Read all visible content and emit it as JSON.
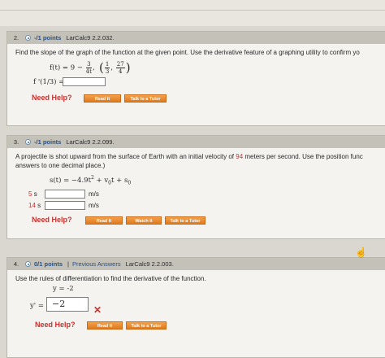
{
  "problems": [
    {
      "number": "2.",
      "points": "-/1 points",
      "ref": "LarCalc9 2.2.032.",
      "question": "Find the slope of the graph of the function at the given point. Use the derivative feature of a graphing utility to confirm yo",
      "f_lhs": "f(t) = 9 −",
      "frac_num": "3",
      "frac_den": "4t",
      "point_x_num": "1",
      "point_x_den": "3",
      "point_y_num": "27",
      "point_y_den": "4",
      "answer_label": "f '(1/3) =",
      "answer_value": "",
      "need_help": "Need Help?",
      "buttons": [
        "Read It",
        "Talk to a Tutor"
      ]
    },
    {
      "number": "3.",
      "points": "-/1 points",
      "ref": "LarCalc9 2.2.099.",
      "question_a": "A projectile is shot upward from the surface of Earth with an initial velocity of",
      "velocity": "94",
      "question_b": "meters per second. Use the position func",
      "question_line2": "answers to one decimal place.)",
      "equation_left": "s(t) = −4.9t",
      "equation_exp": "2",
      "equation_right": "+ v",
      "v_sub": "0",
      "equation_mid": "t + s",
      "s_sub": "0",
      "rows": [
        {
          "time": "5",
          "unit": "s",
          "answer_unit": "m/s"
        },
        {
          "time": "14",
          "unit": "s",
          "answer_unit": "m/s"
        }
      ],
      "need_help": "Need Help?",
      "buttons": [
        "Read It",
        "Watch It",
        "Talk to a Tutor"
      ]
    },
    {
      "number": "4.",
      "points": "0/1 points",
      "separator": "|",
      "previous": "Previous Answers",
      "ref": "LarCalc9 2.2.003.",
      "question": "Use the rules of differentiation to find the derivative of the function.",
      "function": "y = -2",
      "answer_label": "y' =",
      "answer_value": "−2",
      "need_help": "Need Help?",
      "buttons": [
        "Read It",
        "Talk to a Tutor"
      ]
    }
  ]
}
